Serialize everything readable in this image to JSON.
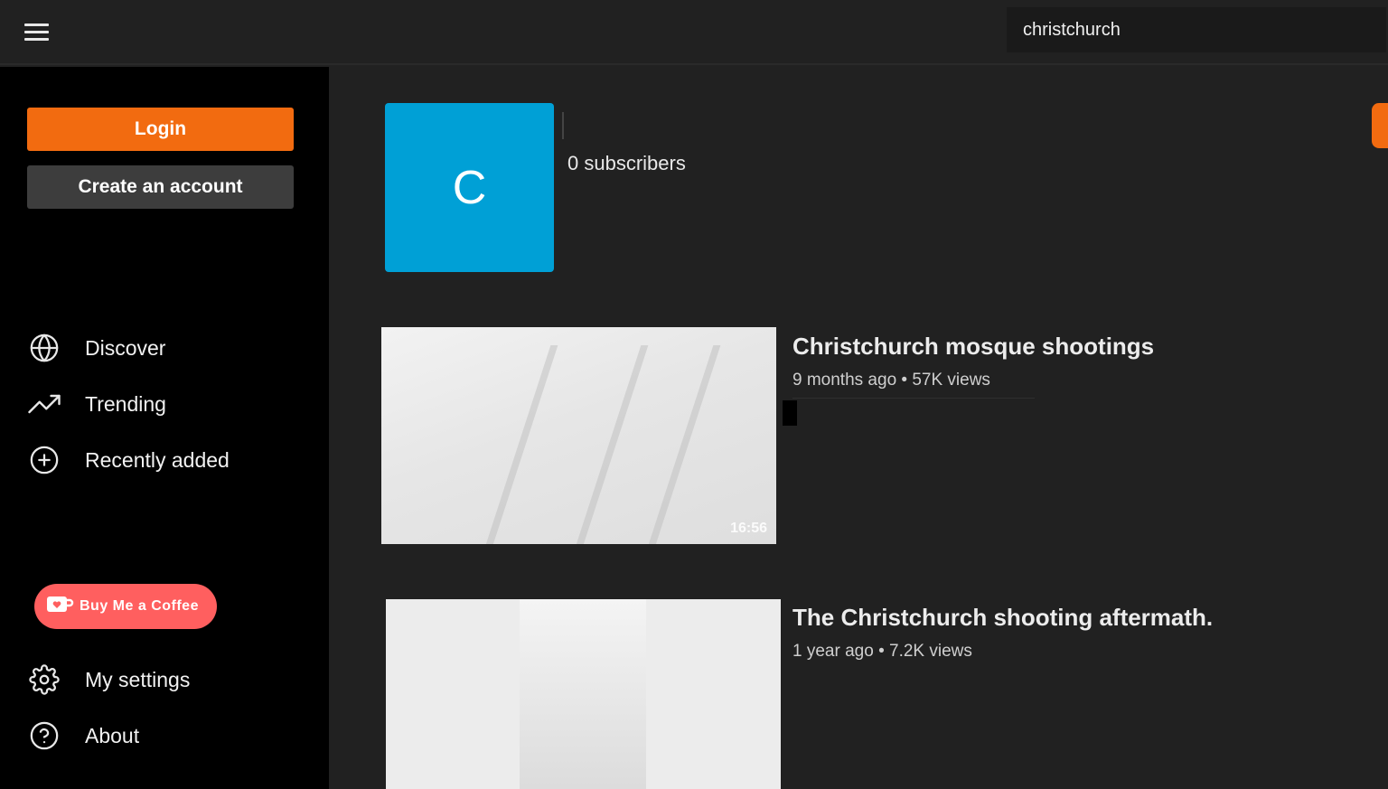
{
  "header": {
    "menu_icon": "hamburger-menu-icon",
    "search": {
      "value": "christchurch",
      "placeholder": ""
    }
  },
  "sidebar": {
    "login_label": "Login",
    "create_account_label": "Create an account",
    "nav": [
      {
        "label": "Discover",
        "icon": "globe-icon"
      },
      {
        "label": "Trending",
        "icon": "trending-icon"
      },
      {
        "label": "Recently added",
        "icon": "plus-circle-icon"
      }
    ],
    "coffee_label": "Buy Me a Coffee",
    "bottom_nav": [
      {
        "label": "My settings",
        "icon": "gear-icon"
      },
      {
        "label": "About",
        "icon": "help-circle-icon"
      }
    ]
  },
  "channel": {
    "avatar_letter": "C",
    "subscribers": "0 subscribers",
    "avatar_color": "#00a0d6"
  },
  "videos": [
    {
      "title": "Christchurch mosque shootings",
      "meta": "9 months ago • 57K views",
      "duration": "16:56"
    },
    {
      "title": "The Christchurch shooting aftermath.",
      "meta": "1 year ago • 7.2K views"
    }
  ],
  "colors": {
    "accent": "#f26b10",
    "coffee": "#ff5f5f",
    "background": "#212121",
    "sidebar": "#000000"
  }
}
